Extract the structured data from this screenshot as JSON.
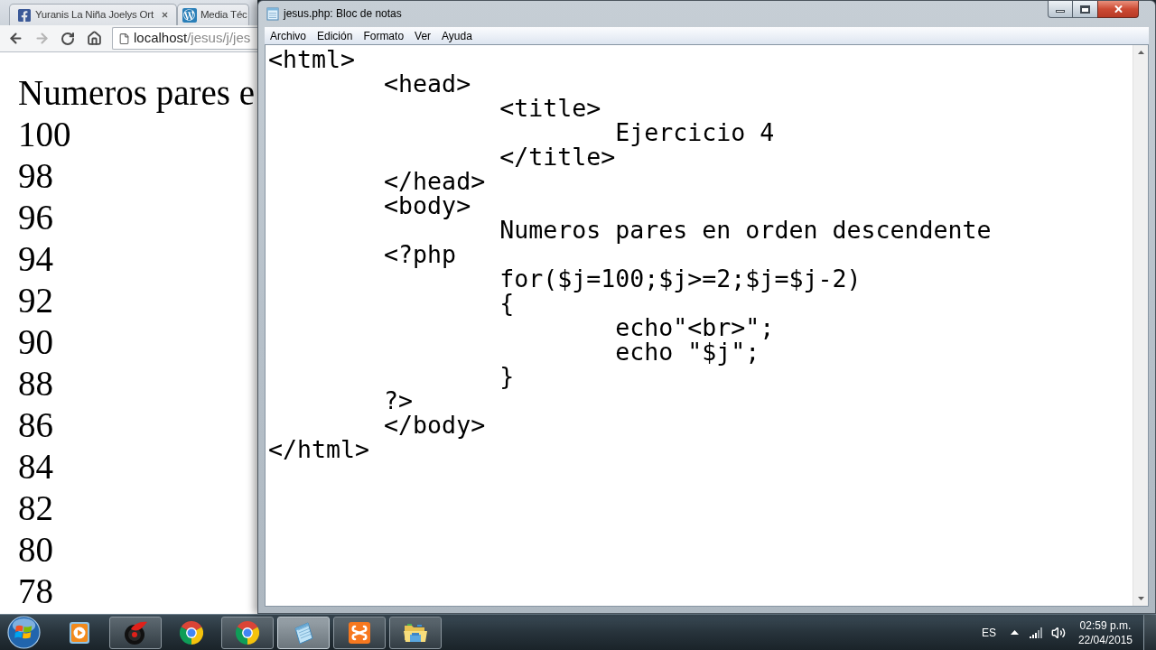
{
  "browser": {
    "tabs": [
      {
        "kind": "facebook",
        "label": "Yuranis La Niña Joelys Ort",
        "selected": false,
        "closable": true
      },
      {
        "kind": "wordpress",
        "label": "Media Téc",
        "selected": false,
        "closable": false
      }
    ],
    "back": {
      "disabled": false
    },
    "forward": {
      "disabled": true
    },
    "address_bar": {
      "host": "localhost",
      "path": "/jesus/j/jes"
    },
    "page": {
      "lines": [
        "Numeros pares e",
        "100",
        "98",
        "96",
        "94",
        "92",
        "90",
        "88",
        "86",
        "84",
        "82",
        "80",
        "78"
      ]
    }
  },
  "notepad": {
    "title": "jesus.php: Bloc de notas",
    "menu": [
      "Archivo",
      "Edición",
      "Formato",
      "Ver",
      "Ayuda"
    ],
    "lines": [
      "<html>",
      "\t<head>",
      "\t\t<title>",
      "\t\t\tEjercicio 4",
      "\t\t</title>",
      "\t</head>",
      "\t<body>",
      "\t\tNumeros pares en orden descendente",
      "\t<?php",
      "\t\tfor($j=100;$j>=2;$j=$j-2)",
      "\t\t{",
      "\t\t\techo\"<br>\";",
      "\t\t\techo \"$j\";",
      "\t\t}",
      "\t?>",
      "\t</body>",
      "</html>"
    ]
  },
  "taskbar": {
    "apps": [
      {
        "kind": "media-player",
        "running": false,
        "selected": false
      },
      {
        "kind": "recorder",
        "running": true,
        "selected": false
      },
      {
        "kind": "chrome",
        "running": false,
        "selected": false
      },
      {
        "kind": "chrome",
        "running": true,
        "selected": false
      },
      {
        "kind": "notepad",
        "running": true,
        "selected": true
      },
      {
        "kind": "xampp",
        "running": true,
        "selected": false
      },
      {
        "kind": "folder",
        "running": true,
        "selected": false
      }
    ],
    "tray": {
      "language": "ES",
      "time": "02:59 p.m.",
      "date": "22/04/2015"
    }
  }
}
